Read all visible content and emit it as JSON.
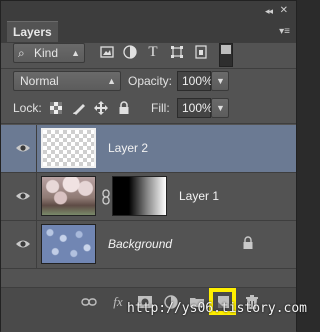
{
  "panel": {
    "tab_title": "Layers",
    "collapse_glyph": "◂◂",
    "close_glyph": "✕",
    "menu_glyph": "▾≡"
  },
  "filter": {
    "kind_label": "Kind",
    "search_glyph": "⌕",
    "icons": [
      "image-filter-icon",
      "adjustment-filter-icon",
      "type-filter-icon",
      "shape-filter-icon",
      "smart-object-filter-icon"
    ]
  },
  "blend": {
    "mode": "Normal",
    "opacity_label": "Opacity:",
    "opacity_value": "100%",
    "lock_label": "Lock:",
    "fill_label": "Fill:",
    "fill_value": "100%"
  },
  "layers": [
    {
      "name": "Layer 2",
      "selected": true,
      "thumbnail": "transparent-checker"
    },
    {
      "name": "Layer 1",
      "selected": false,
      "thumbnail": "cherry-blossom-photo",
      "mask": "gradient-mask"
    },
    {
      "name": "Background",
      "selected": false,
      "thumbnail": "blue-pebbles-photo",
      "locked": true
    }
  ],
  "bottom": {
    "icons": [
      "link-layers-icon",
      "fx-icon",
      "add-mask-icon",
      "new-fill-adjustment-icon",
      "new-group-icon",
      "new-layer-icon",
      "delete-layer-icon"
    ],
    "fx_label": "fx"
  },
  "watermark": "http://ys06.tistory.com",
  "colors": {
    "selected_row": "#6b7a93",
    "highlight": "#ffef00",
    "panel_bg": "#535353"
  }
}
